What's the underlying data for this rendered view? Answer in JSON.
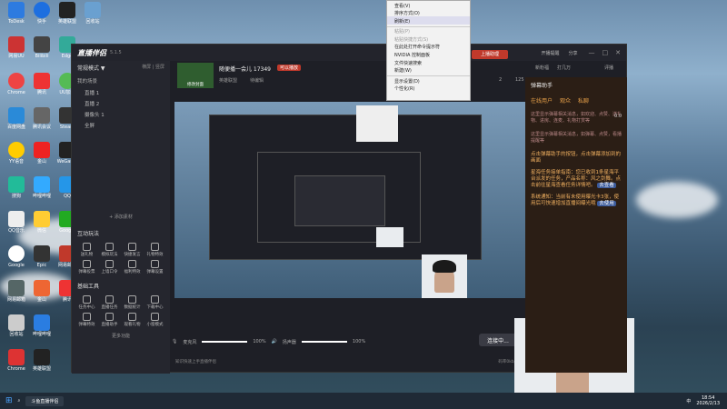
{
  "context_menu": {
    "items": [
      "查看(V)",
      "排序方式(O)",
      "刷新(E)",
      "",
      "粘贴(P)",
      "粘贴快捷方式(S)",
      "在此处打开命令提示符",
      "NVIDIA 控制面板",
      "文件快速搜索",
      "新建(W)",
      "",
      "显示设置(D)",
      "个性化(R)"
    ]
  },
  "app": {
    "logo_text": "直播伴侣",
    "version": "5.1.5",
    "stream_title": "随便播一会儿 17349",
    "category_badge": "可以播放",
    "tags": [
      "英雄联盟",
      "待编辑"
    ],
    "cover_label": "修改封面",
    "right_header": {
      "open_live": "开播提醒",
      "share": "分享",
      "live_btn": "上播助理",
      "stats": [
        "2",
        "125"
      ],
      "tab_labels": [
        "新粉福",
        "打几万",
        "评播"
      ]
    },
    "sidebar": {
      "mode_title": "常规模式",
      "mode_tabs": [
        "横屏",
        "竖屏"
      ],
      "scene_header": "我的场景",
      "scenes": [
        "直播 1",
        "直播 2",
        "摄像头 1",
        "全屏"
      ],
      "add_source": "添加素材",
      "interactive_title": "互动玩法",
      "interactive_tools": [
        "送礼物",
        "模拟玩法",
        "快捷发言",
        "礼物特效",
        "弹幕投票",
        "上墙口令",
        "福利特效",
        "弹幕设置"
      ],
      "basic_title": "基础工具",
      "basic_tools": [
        "任务中心",
        "直播任务",
        "数据统计",
        "下载中心",
        "弹幕特效",
        "直播助手",
        "观看礼物",
        "小窗模式"
      ],
      "more": "更多功能"
    },
    "bottom_bar": {
      "mic_label": "麦克风",
      "mic_pct": "100%",
      "speaker_label": "扬声器",
      "speaker_pct": "100%",
      "btns": [
        "美颜",
        "录制",
        "设置"
      ],
      "go_live": "连接中...",
      "status_text": "知识快速上手直播伴侣",
      "stats": [
        "码率0kb/s",
        "FPS:60",
        "延迟 0ms(0:00)",
        "CPU:2%",
        "内存:56%"
      ]
    },
    "right_panel": {
      "title": "弹幕助手",
      "tabs": [
        "在线用户",
        "观众",
        "私聊"
      ],
      "count": "0.0",
      "msg1": "这里显示弹幕相关消息，如欢迎、点赞、送礼物、进房、连麦、礼物打赏等",
      "msg2": "这里显示弹幕相关消息，如弹幕、点赞，看播提醒等",
      "msg3": "点击弹幕助手的按钮，点击弹幕添加到的画面",
      "msg4": "星海任务接单指南：您已收到1条星海平台派发的任务，产品名称：风之剑舞。点击前往星海查看任务详情吧。",
      "link1": "去查看",
      "msg5": "系统通知：当前有未使用曝光卡3张，使用后可快速增加直播间曝光哦",
      "link2": "去使用"
    }
  },
  "desktop_icons": [
    "ToDesk",
    "快手",
    "英雄联盟",
    "回收站",
    "网易UU",
    "Bilibili",
    "Chrome",
    "腾讯",
    "Edge",
    "UU加速",
    "Steam",
    "WeGame",
    "百度网盘",
    "腾讯会议",
    "哔哩哔哩",
    "QQ",
    "QQ音乐",
    "Google",
    "微信",
    "Epic",
    "网易邮箱",
    "YY语音",
    "金山",
    "搜狗"
  ],
  "taskbar": {
    "search_label": "斗鱼直播伴侣",
    "time": "18:54",
    "date": "2026/2/13",
    "lang": "中"
  }
}
